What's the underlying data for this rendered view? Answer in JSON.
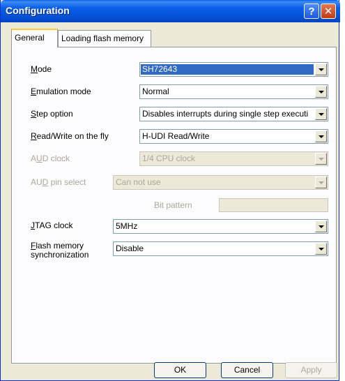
{
  "window": {
    "title": "Configuration"
  },
  "tabs": [
    {
      "label": "General"
    },
    {
      "label": "Loading flash memory"
    }
  ],
  "fields": {
    "mode": {
      "label_pre": "",
      "label_u": "M",
      "label_post": "ode",
      "value": "SH72643"
    },
    "emulation_mode": {
      "label_pre": "",
      "label_u": "E",
      "label_post": "mulation mode",
      "value": "Normal"
    },
    "step_option": {
      "label_pre": "",
      "label_u": "S",
      "label_post": "tep option",
      "value": "Disables interrupts during single step executi"
    },
    "read_write": {
      "label_pre": "",
      "label_u": "R",
      "label_post": "ead/Write on the fly",
      "value": "H-UDI Read/Write"
    },
    "aud_clock": {
      "label_pre": "A",
      "label_u": "U",
      "label_post": "D clock",
      "value": "1/4 CPU clock"
    },
    "aud_pin_select": {
      "label_pre": "AU",
      "label_u": "D",
      "label_post": " pin select",
      "value": "Can not use"
    },
    "bit_pattern": {
      "label": "Bit pattern",
      "value": ""
    },
    "jtag_clock": {
      "label_pre": "",
      "label_u": "J",
      "label_post": "TAG clock",
      "value": "5MHz"
    },
    "flash_sync": {
      "label_line1_pre": "",
      "label_line1_u": "F",
      "label_line1_post": "lash memory",
      "label_line2": "synchronization",
      "value": "Disable"
    }
  },
  "buttons": {
    "ok": "OK",
    "cancel": "Cancel",
    "apply": "Apply"
  },
  "icons": {
    "help": "help-icon",
    "close": "close-icon"
  },
  "colors": {
    "titlebar": "#0553d9",
    "dialog": "#ece9d8",
    "selection": "#316ac5"
  }
}
